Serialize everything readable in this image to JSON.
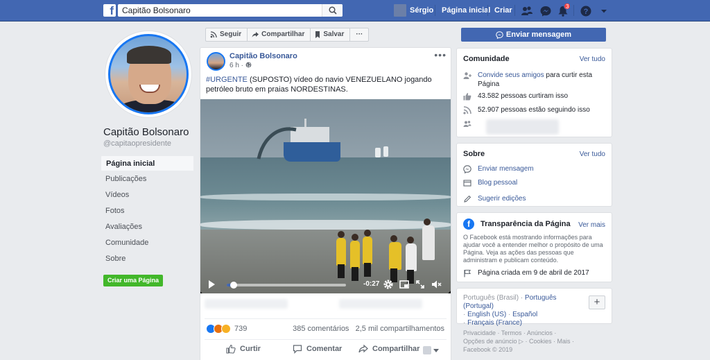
{
  "topbar": {
    "logo": "f",
    "search_value": "Capitão Bolsonaro",
    "user_name": "Sérgio",
    "home_label": "Página inicial",
    "create_label": "Criar",
    "notifications_count": "3",
    "brand_color": "#4267b2"
  },
  "profile": {
    "name": "Capitão Bolsonaro",
    "handle": "@capitaopresidente"
  },
  "left_nav": {
    "items": [
      "Página inicial",
      "Publicações",
      "Vídeos",
      "Fotos",
      "Avaliações",
      "Comunidade",
      "Sobre"
    ],
    "active_index": 0,
    "create_page_label": "Criar uma Página"
  },
  "action_bar": {
    "follow_label": "Seguir",
    "share_label": "Compartilhar",
    "save_label": "Salvar",
    "more_label": "···"
  },
  "post": {
    "author": "Capitão Bolsonaro",
    "time": "6 h",
    "more_label": "•••",
    "hashtag": "#URGENTE",
    "text": " (SUPOSTO) vídeo do navio VENEZUELANO jogando petróleo bruto em praias NORDESTINAS.",
    "video": {
      "time_remaining": "-0:27",
      "progress": 0.06
    },
    "reactions_count": "739",
    "comments": "385 comentários",
    "shares": "2,5 mil compartilhamentos",
    "actions": {
      "like": "Curtir",
      "comment": "Comentar",
      "share": "Compartilhar"
    }
  },
  "right": {
    "send_message_label": "Enviar mensagem",
    "community": {
      "title": "Comunidade",
      "see_all": "Ver tudo",
      "invite_link": "Convide seus amigos",
      "invite_text": " para curtir esta Página",
      "likes": "43.582 pessoas curtiram isso",
      "followers": "52.907 pessoas estão seguindo isso"
    },
    "about": {
      "title": "Sobre",
      "see_all": "Ver tudo",
      "send_message": "Enviar mensagem",
      "blog": "Blog pessoal",
      "suggest": "Sugerir edições"
    },
    "transparency": {
      "title": "Transparência da Página",
      "see_more": "Ver mais",
      "description": "O Facebook está mostrando informações para ajudar você a entender melhor o propósito de uma Página. Veja as ações das pessoas que administram e publicam conteúdo.",
      "created": "Página criada em 9 de abril de 2017"
    },
    "languages": {
      "current": "Português (Brasil)",
      "options": [
        "Português (Portugal)",
        "English (US)",
        "Español",
        "Français (France)"
      ],
      "plus": "+"
    },
    "footer": {
      "line1": "Privacidade · Termos · Anúncios ·",
      "line2": "Opções de anúncio ▷ · Cookies · Mais ·",
      "line3": "Facebook © 2019"
    }
  }
}
